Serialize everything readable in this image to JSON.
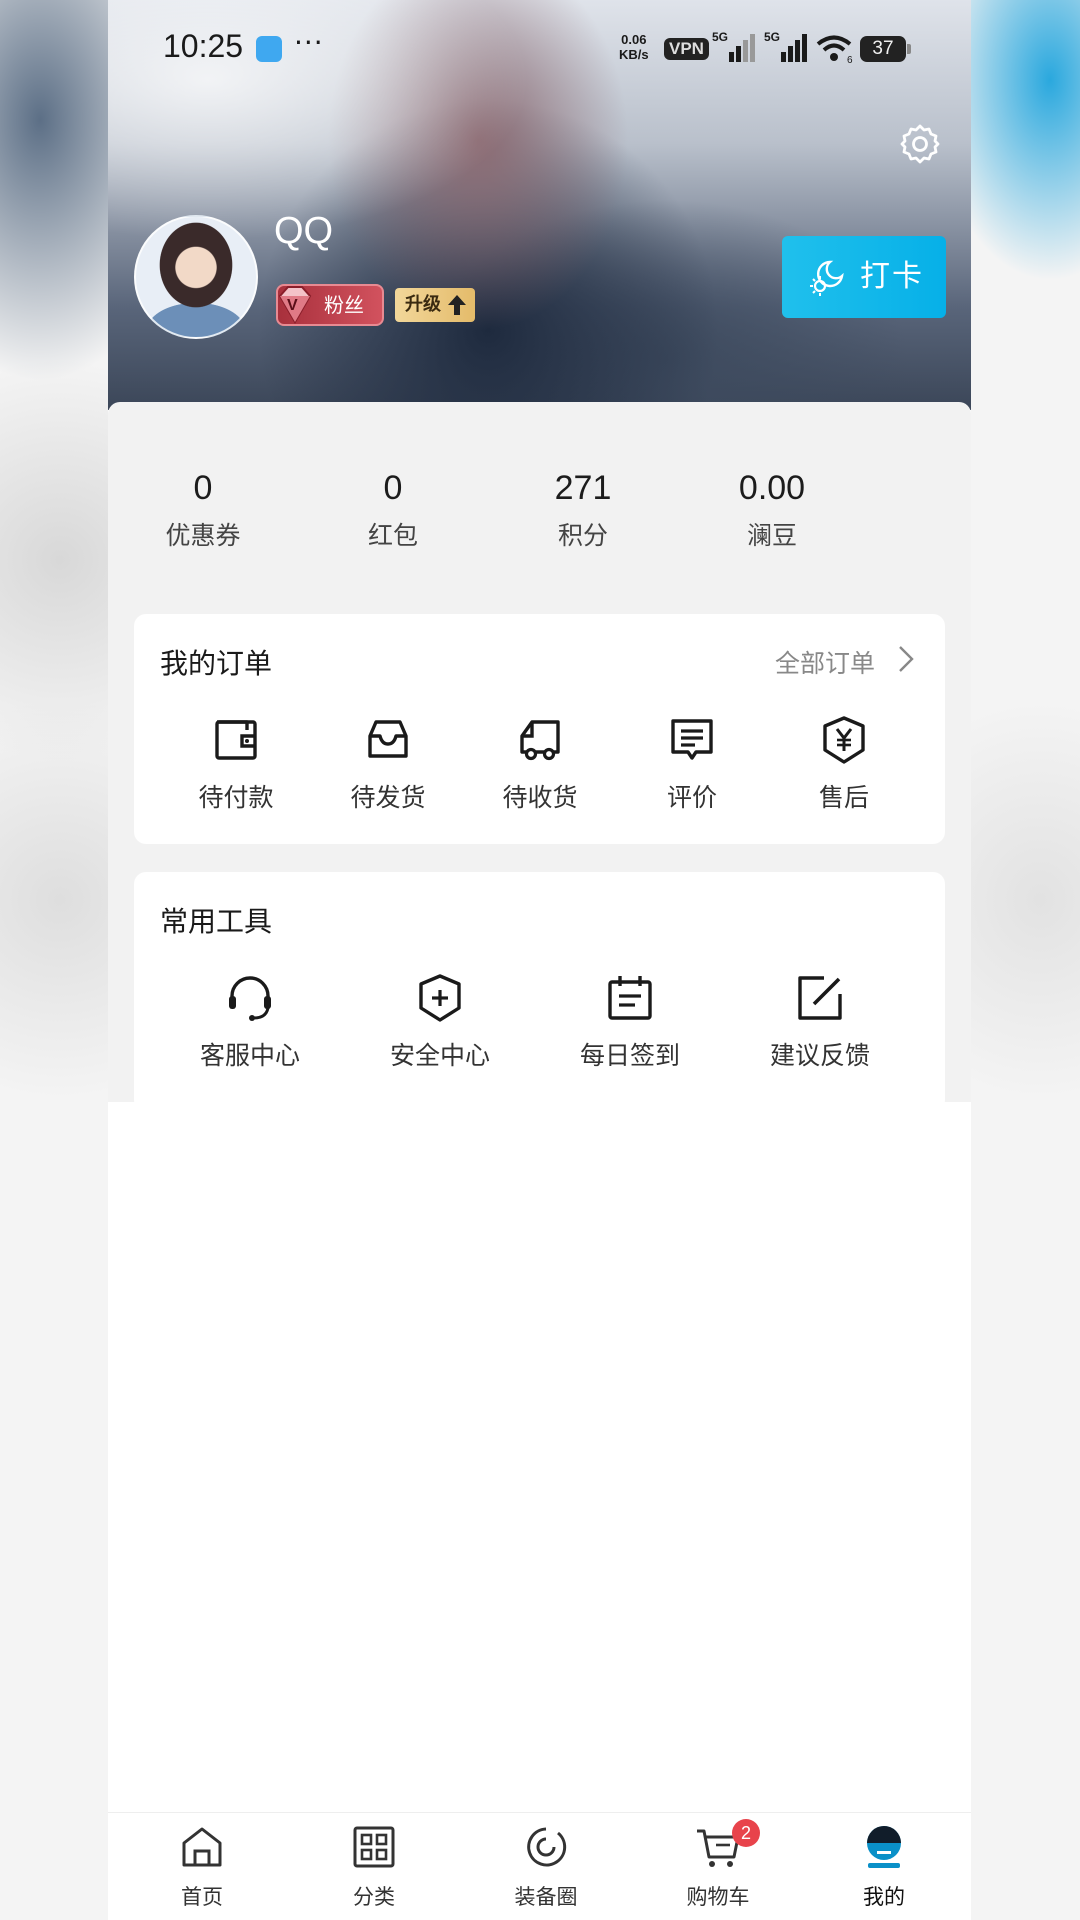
{
  "status_bar": {
    "time": "10:25",
    "dots": "···",
    "net_speed_value": "0.06",
    "net_speed_unit": "KB/s",
    "vpn": "VPN",
    "signal1": "5G",
    "signal2": "5G",
    "wifi_sub": "6",
    "battery": "37"
  },
  "profile": {
    "username": "QQ",
    "vip_label": "粉丝",
    "upgrade_label": "升级",
    "checkin_label": "打卡"
  },
  "stats": [
    {
      "value": "0",
      "label": "优惠券"
    },
    {
      "value": "0",
      "label": "红包"
    },
    {
      "value": "271",
      "label": "积分"
    },
    {
      "value": "0.00",
      "label": "澜豆"
    }
  ],
  "orders": {
    "title": "我的订单",
    "more": "全部订单",
    "items": [
      {
        "label": "待付款",
        "icon": "wallet-icon"
      },
      {
        "label": "待发货",
        "icon": "inbox-icon"
      },
      {
        "label": "待收货",
        "icon": "truck-icon"
      },
      {
        "label": "评价",
        "icon": "comment-icon"
      },
      {
        "label": "售后",
        "icon": "yuan-shield-icon"
      }
    ]
  },
  "tools": {
    "title": "常用工具",
    "items": [
      {
        "label": "客服中心",
        "icon": "headset-icon"
      },
      {
        "label": "安全中心",
        "icon": "security-shield-icon"
      },
      {
        "label": "每日签到",
        "icon": "calendar-icon"
      },
      {
        "label": "建议反馈",
        "icon": "edit-icon"
      }
    ]
  },
  "tabbar": {
    "items": [
      {
        "label": "首页",
        "icon": "home-icon"
      },
      {
        "label": "分类",
        "icon": "category-icon"
      },
      {
        "label": "装备圈",
        "icon": "circle-icon"
      },
      {
        "label": "购物车",
        "icon": "cart-icon",
        "badge": "2"
      },
      {
        "label": "我的",
        "icon": "profile-icon",
        "active": true
      }
    ]
  },
  "colors": {
    "accent": "#06b0e8",
    "badge": "#e8434b",
    "vip": "#c0404c",
    "upgrade": "#e4bb6a"
  }
}
